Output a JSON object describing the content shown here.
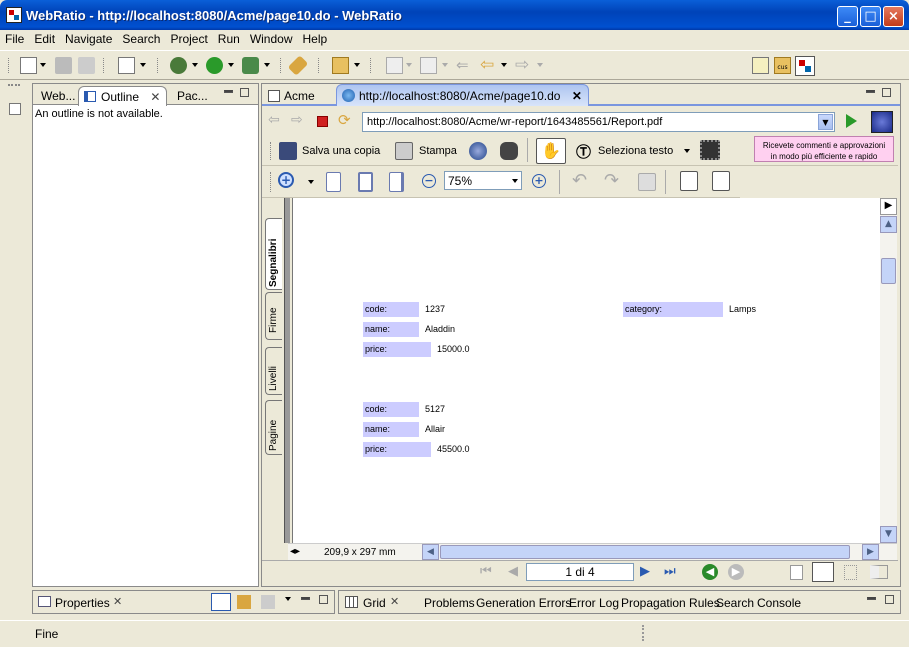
{
  "window": {
    "title": "WebRatio - http://localhost:8080/Acme/page10.do - WebRatio"
  },
  "menu": [
    "File",
    "Edit",
    "Navigate",
    "Search",
    "Project",
    "Run",
    "Window",
    "Help"
  ],
  "left_panel": {
    "tabs": [
      "Web...",
      "Outline",
      "Pac..."
    ],
    "outline_message": "An outline is not available."
  },
  "editor": {
    "tabs": [
      "Acme",
      "http://localhost:8080/Acme/page10.do"
    ],
    "url": "http://localhost:8080/Acme/wr-report/1643485561/Report.pdf"
  },
  "pdf": {
    "save_label": "Salva una copia",
    "print_label": "Stampa",
    "select_text_label": "Seleziona testo",
    "promo_line1": "Ricevete commenti e approvazioni",
    "promo_line2": "in modo più efficiente e rapido",
    "zoom": "75%",
    "side_tabs": [
      "Segnalibri",
      "Firme",
      "Livelli",
      "Pagine"
    ],
    "page_size": "209,9 x 297 mm",
    "page_indicator": "1 di 4",
    "records": [
      {
        "code_label": "code:",
        "code": "1237",
        "name_label": "name:",
        "name": "Aladdin",
        "price_label": "price:",
        "price": "15000.0",
        "category_label": "category:",
        "category": "Lamps"
      },
      {
        "code_label": "code:",
        "code": "5127",
        "name_label": "name:",
        "name": "Allair",
        "price_label": "price:",
        "price": "45500.0"
      }
    ]
  },
  "bottom": {
    "properties_tab": "Properties",
    "tabs": [
      "Grid",
      "Problems",
      "Generation Errors",
      "Error Log",
      "Propagation Rules",
      "Search",
      "Console"
    ]
  },
  "status": {
    "text": "Fine"
  }
}
